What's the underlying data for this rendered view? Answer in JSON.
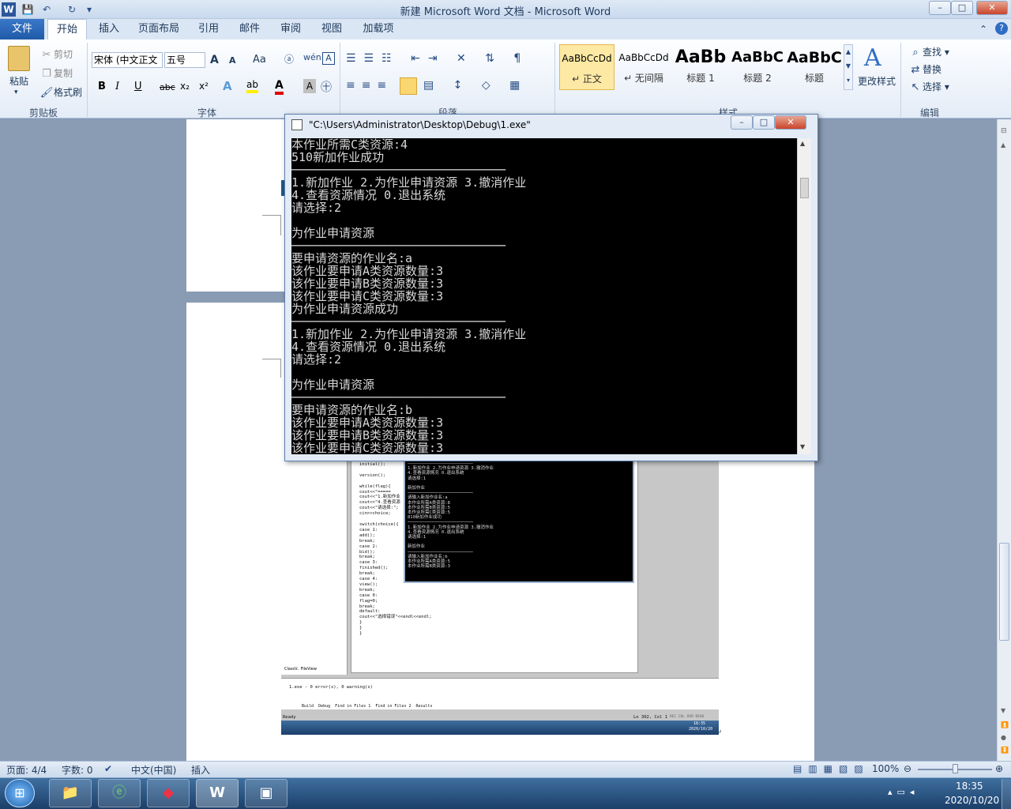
{
  "window": {
    "title": "新建 Microsoft Word 文档 - Microsoft Word",
    "minimize": "–",
    "restore": "□",
    "close": "✕"
  },
  "quick_access": {
    "app_icon": "W",
    "save": "💾",
    "undo": "↶",
    "redo": "↻",
    "more": "▾"
  },
  "tabs": {
    "file": "文件",
    "items": [
      "开始",
      "插入",
      "页面布局",
      "引用",
      "邮件",
      "审阅",
      "视图",
      "加载项"
    ]
  },
  "clipboard": {
    "paste": "粘贴",
    "cut": "剪切",
    "copy": "复制",
    "format_painter": "格式刷",
    "label": "剪贴板"
  },
  "font": {
    "name": "宋体 (中文正文",
    "size": "五号",
    "grow": "A",
    "shrink": "A",
    "change_case": "Aa",
    "bold": "B",
    "italic": "I",
    "underline": "U",
    "strike": "abc",
    "subscript": "x₂",
    "superscript": "x²",
    "label": "字体"
  },
  "paragraph": {
    "label": "段落"
  },
  "styles": {
    "items": [
      {
        "sample": "AaBbCcDd",
        "name": "↵ 正文"
      },
      {
        "sample": "AaBbCcDd",
        "name": "↵ 无间隔"
      },
      {
        "sample": "AaBb",
        "name": "标题 1"
      },
      {
        "sample": "AaBbC",
        "name": "标题 2"
      },
      {
        "sample": "AaBbC",
        "name": "标题"
      }
    ],
    "change": "更改样式",
    "label": "样式"
  },
  "editing": {
    "find": "查找",
    "replace": "替换",
    "select": "选择",
    "label": "编辑"
  },
  "console": {
    "title": "\"C:\\Users\\Administrator\\Desktop\\Debug\\1.exe\"",
    "lines": [
      "本作业所需C类资源:4",
      "510新加作业成功",
      "──────────────────────────────",
      "1.新加作业 2.为作业申请资源 3.撤消作业",
      "4.查看资源情况 0.退出系统",
      "请选择:2",
      "",
      "为作业申请资源",
      "──────────────────────────────",
      "要申请资源的作业名:a",
      "该作业要申请A类资源数量:3",
      "该作业要申请B类资源数量:3",
      "该作业要申请C类资源数量:3",
      "为作业申请资源成功",
      "──────────────────────────────",
      "1.新加作业 2.为作业申请资源 3.撤消作业",
      "4.查看资源情况 0.退出系统",
      "请选择:2",
      "",
      "为作业申请资源",
      "──────────────────────────────",
      "要申请资源的作业名:b",
      "该作业要申请A类资源数量:3",
      "该作业要申请B类资源数量:3",
      "该作业要申请C类资源数量:3"
    ]
  },
  "embedded": {
    "code": "initial();\n\nversion();\n\nwhile(flag){\ncout<<\"=====\ncout<<\"1.新加作业\ncout<<\"4.查看资源\ncout<<\"请选择:\";\ncin>>choice;\n\nswitch(choice){\ncase 1:\nadd();\nbreak;\ncase 2:\nbid();\nbreak;\ncase 3:\nfinished();\nbreak;\ncase 4:\nview();\nbreak;\ncase 0:\nflag=0;\nbreak;\ndefault:\ncout<<\"选择错误\"<<endl<<endl;\n}\n}\n}",
    "console": "─────────────────────────\n1.新加作业 2.为作业申请资源 3.撤消作业\n4.查看资源情况 0.退出系统\n请选择:1\n\n新加作业\n─────────────────────────\n请输入新加作业名:a\n本作业所需A类资源:8\n本作业所需B类资源:5\n本作业所需C类资源:5\n810新加作业成功\n─────────────────────────\n1.新加作业 2.为作业申请资源 3.撤消作业\n4.查看资源情况 0.退出系统\n请选择:1\n\n新加作业\n─────────────────────────\n请输入新加作业名:b\n本作业所需A类资源:5\n本作业所需B类资源:3",
    "tabs_left": "ClassV..  FileView",
    "output": "1.exe - 0 error(s), 0 warning(s)",
    "output_tabs": "Build  Debug  Find in Files 1  Find in Files 2  Results",
    "ready": "Ready",
    "position": "Ln 302, Col 1",
    "indicators": "REC COL OVR READ",
    "clock_time": "18:35",
    "clock_date": "2020/10/20"
  },
  "statusbar": {
    "page": "页面: 4/4",
    "words": "字数: 0",
    "language": "中文(中国)",
    "mode": "插入",
    "zoom": "100%"
  },
  "taskbar": {
    "time": "18:35",
    "date": "2020/10/20"
  }
}
